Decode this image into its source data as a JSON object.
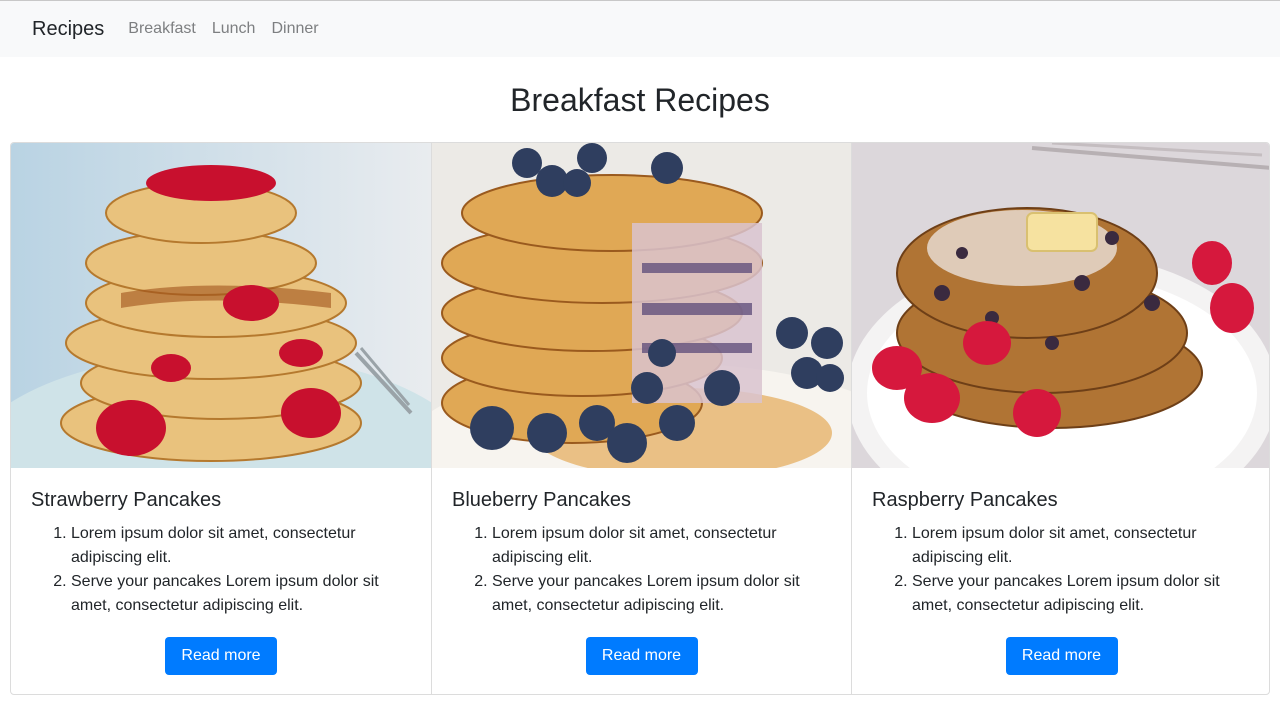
{
  "navbar": {
    "brand": "Recipes",
    "links": [
      "Breakfast",
      "Lunch",
      "Dinner"
    ]
  },
  "page": {
    "title": "Breakfast Recipes"
  },
  "cards": [
    {
      "title": "Strawberry Pancakes",
      "image": "strawberry-pancakes-photo",
      "steps": [
        "Lorem ipsum dolor sit amet, consectetur adipiscing elit.",
        "Serve your pancakes Lorem ipsum dolor sit amet, consectetur adipiscing elit."
      ],
      "button": "Read more"
    },
    {
      "title": "Blueberry Pancakes",
      "image": "blueberry-pancakes-photo",
      "steps": [
        "Lorem ipsum dolor sit amet, consectetur adipiscing elit.",
        "Serve your pancakes Lorem ipsum dolor sit amet, consectetur adipiscing elit."
      ],
      "button": "Read more"
    },
    {
      "title": "Raspberry Pancakes",
      "image": "raspberry-pancakes-photo",
      "steps": [
        "Lorem ipsum dolor sit amet, consectetur adipiscing elit.",
        "Serve your pancakes Lorem ipsum dolor sit amet, consectetur adipiscing elit."
      ],
      "button": "Read more"
    }
  ],
  "colors": {
    "navbar_bg": "#f8f9fa",
    "primary": "#007bff",
    "text": "#212529",
    "nav_link": "#7d7f81"
  }
}
